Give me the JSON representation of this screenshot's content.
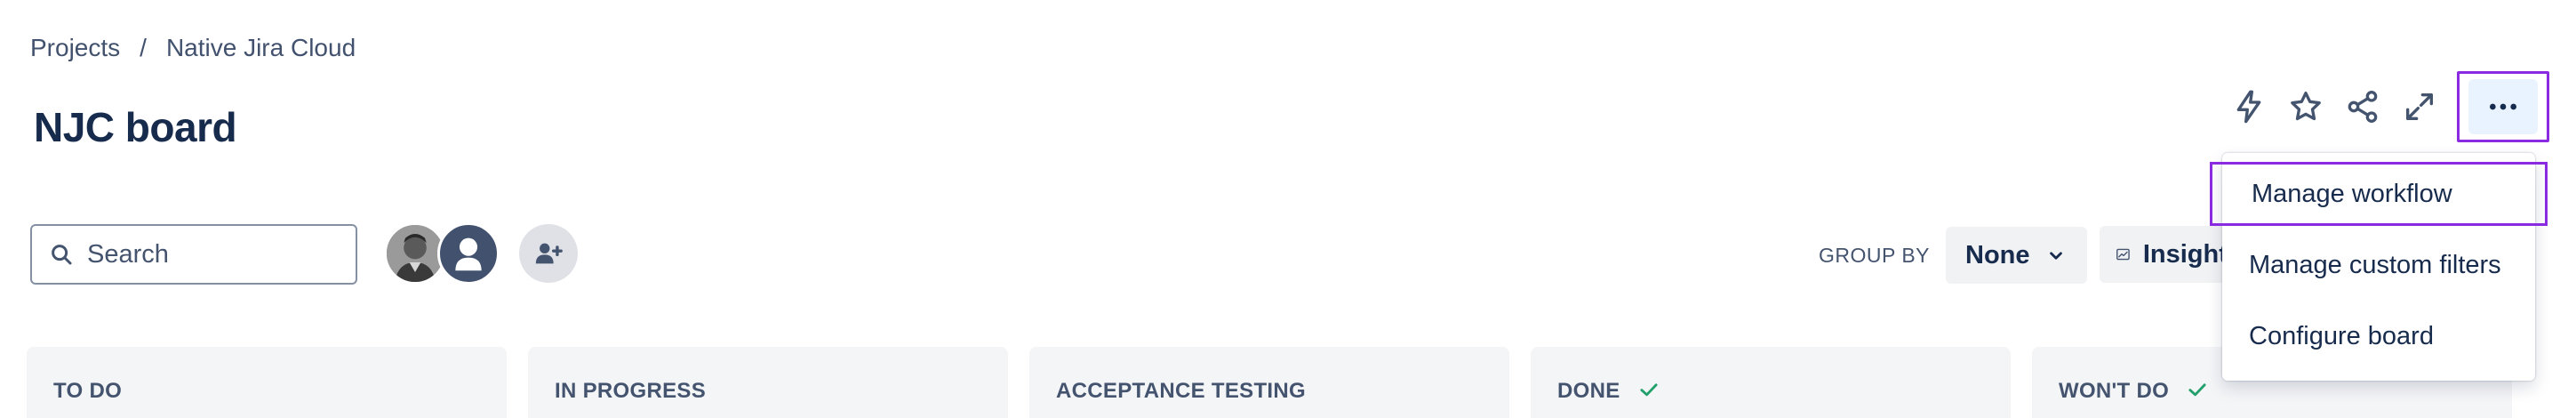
{
  "breadcrumb": {
    "items": [
      "Projects",
      "Native Jira Cloud"
    ],
    "separator": "/"
  },
  "page": {
    "title": "NJC board"
  },
  "header_actions": {
    "icons": [
      "lightning-icon",
      "star-icon",
      "share-icon",
      "expand-icon",
      "more-icon"
    ]
  },
  "toolbar": {
    "search_placeholder": "Search",
    "group_by_label": "GROUP BY",
    "group_by_value": "None",
    "insights_label": "Insights"
  },
  "columns": [
    {
      "title": "TO DO",
      "done": false
    },
    {
      "title": "IN PROGRESS",
      "done": false
    },
    {
      "title": "ACCEPTANCE TESTING",
      "done": false
    },
    {
      "title": "DONE",
      "done": true
    },
    {
      "title": "WON'T DO",
      "done": true
    }
  ],
  "menu": {
    "items": [
      "Manage workflow",
      "Manage custom filters",
      "Configure board"
    ]
  },
  "colors": {
    "highlight": "#8a2be2",
    "text": "#172b4d",
    "check": "#22a06b",
    "selected_bg": "#e9f2ff"
  }
}
